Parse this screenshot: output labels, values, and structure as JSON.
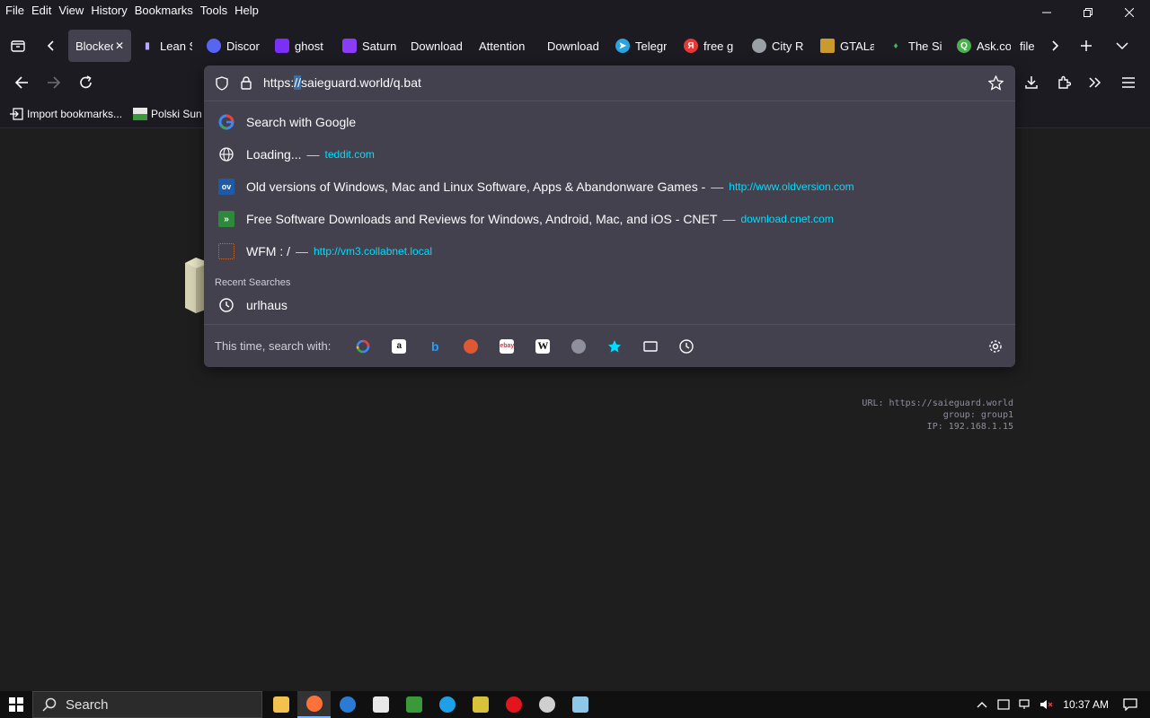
{
  "menu": [
    "File",
    "Edit",
    "View",
    "History",
    "Bookmarks",
    "Tools",
    "Help"
  ],
  "tabs": [
    {
      "label": "Blocked",
      "active": true,
      "color": ""
    },
    {
      "label": "Lean S",
      "color": "#8a6cff"
    },
    {
      "label": "Discor",
      "color": "#5865f2"
    },
    {
      "label": "ghost",
      "color": "#7b2ff7"
    },
    {
      "label": "Saturn",
      "color": "#8b3cf7"
    },
    {
      "label": "Download",
      "color": ""
    },
    {
      "label": "Attention",
      "color": ""
    },
    {
      "label": "Download",
      "color": ""
    },
    {
      "label": "Telegr",
      "color": "#2aa3e0"
    },
    {
      "label": "free g",
      "color": "#e53935"
    },
    {
      "label": "City R",
      "color": "#9aa0a6"
    },
    {
      "label": "GTALa",
      "color": "#c99a2e"
    },
    {
      "label": "The Si",
      "color": "#3cba54"
    },
    {
      "label": "Ask.co",
      "color": "#4caf50"
    },
    {
      "label": "file",
      "color": ""
    }
  ],
  "urlbar": {
    "url_prefix": "https:",
    "url_selected": "//",
    "url_rest": "saieguard.world/q.bat"
  },
  "bookmarks": [
    {
      "label": "Import bookmarks..."
    },
    {
      "label": "Polski Sun"
    }
  ],
  "results": [
    {
      "title": "Search with Google",
      "url": "",
      "icon": "google"
    },
    {
      "title": "Loading...",
      "url": "teddit.com",
      "icon": "globe"
    },
    {
      "title": "Old versions of Windows, Mac and Linux Software, Apps & Abandonware Games -",
      "url": "http://www.oldversion.com",
      "icon": "ov"
    },
    {
      "title": "Free Software Downloads and Reviews for Windows, Android, Mac, and iOS - CNET",
      "url": "download.cnet.com",
      "icon": "cnet"
    },
    {
      "title": "WFM : /",
      "url": "http://vm3.collabnet.local",
      "icon": "wfm"
    }
  ],
  "recent_label": "Recent Searches",
  "recent": [
    {
      "title": "urlhaus"
    }
  ],
  "oneoff_label": "This time, search with:",
  "engines": [
    "google",
    "amazon",
    "bing",
    "duckduckgo",
    "ebay",
    "wikipedia",
    "search",
    "bookmarks",
    "tabs",
    "history"
  ],
  "page_info": {
    "url_line": "URL: https://saieguard.world",
    "group_line": "group: group1",
    "ip_line": "IP: 192.168.1.15"
  },
  "taskbar": {
    "search_label": "Search",
    "clock": "10:37 AM"
  }
}
